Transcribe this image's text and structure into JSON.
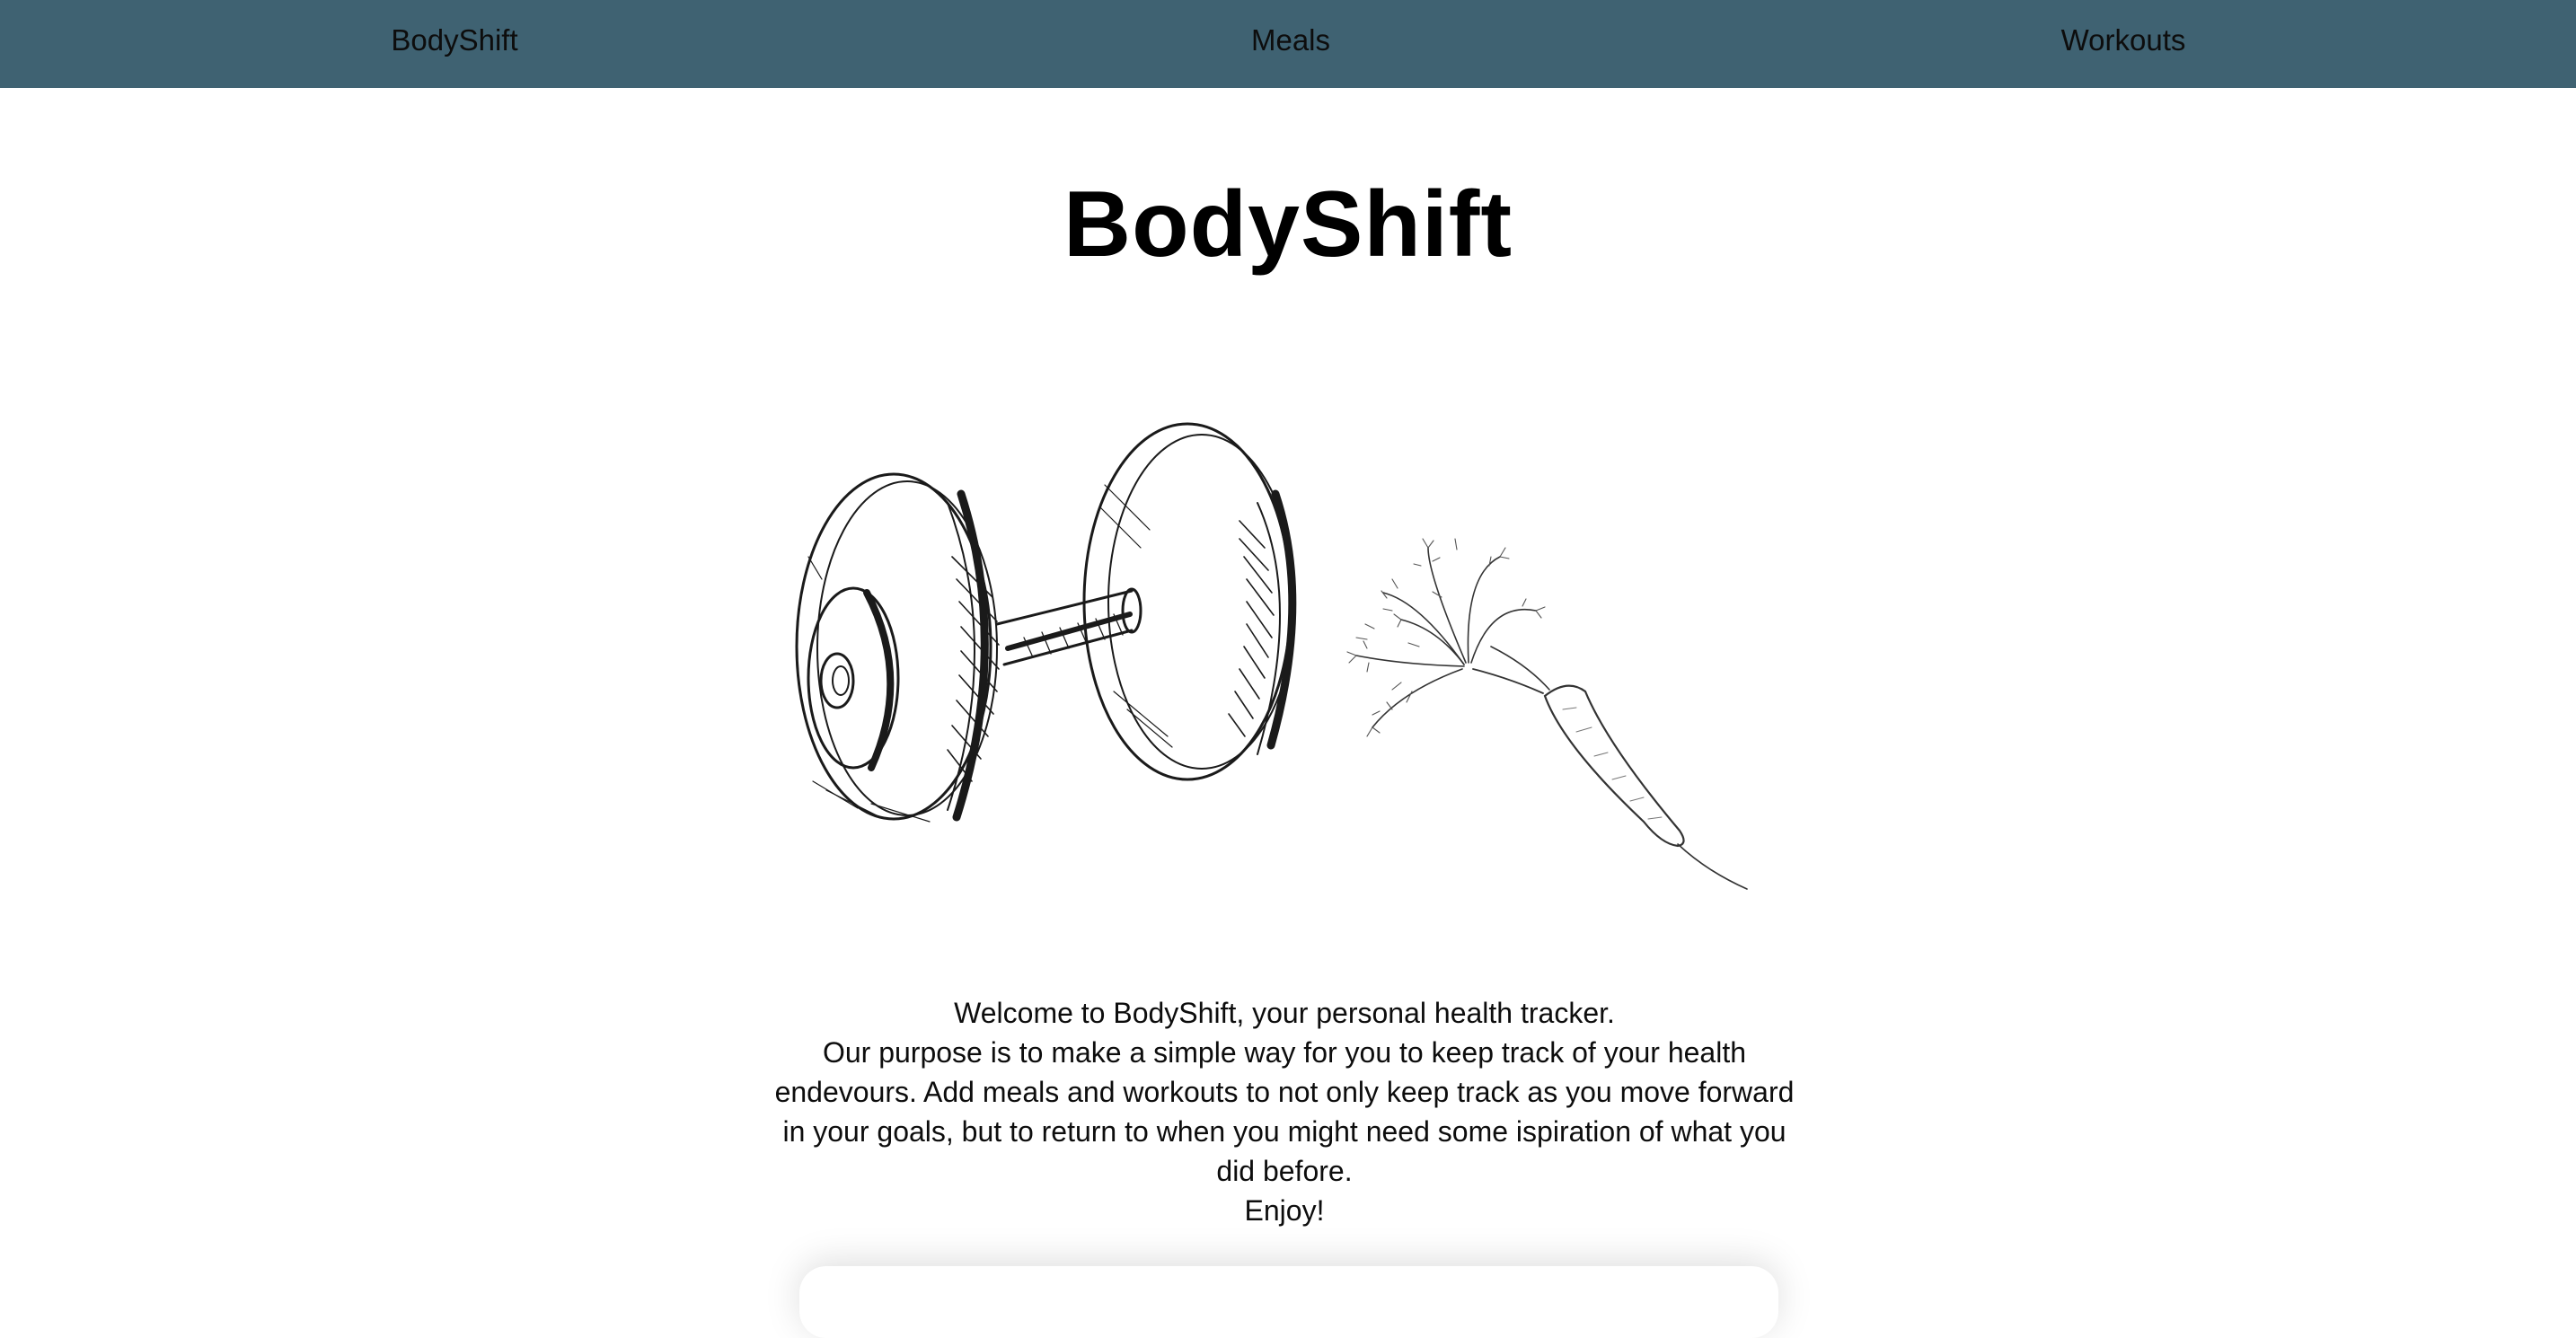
{
  "nav": {
    "brand": "BodyShift",
    "meals": "Meals",
    "workouts": "Workouts"
  },
  "header": {
    "title": "BodyShift"
  },
  "hero": {
    "icons": [
      "dumbbell-icon",
      "carrot-icon"
    ]
  },
  "intro": {
    "welcome": "Welcome to BodyShift, your personal health tracker.",
    "purpose": "Our purpose is to make a simple way for you to keep track of your health endevours. Add meals and workouts to not only keep track as you move forward in your goals, but to return to when you might need some ispiration of what you did before.",
    "closing": "Enjoy!"
  },
  "colors": {
    "navbar_bg": "#3f6272",
    "text": "#0d0d0d",
    "background": "#ffffff"
  }
}
